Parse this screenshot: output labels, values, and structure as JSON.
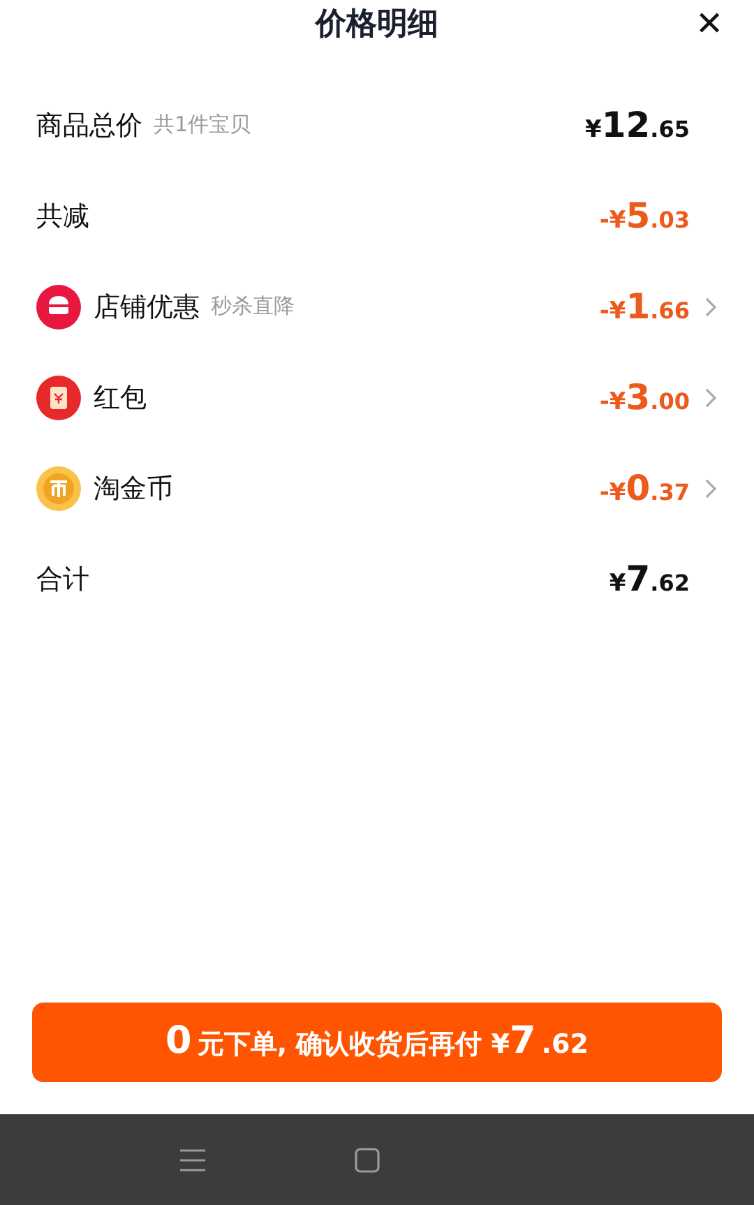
{
  "header": {
    "title": "价格明细",
    "close_icon": "✕"
  },
  "rows": [
    {
      "kind": "plain",
      "label": "商品总价",
      "note": "共1件宝贝",
      "discount": false,
      "amount": {
        "prefix": "¥",
        "int": "12",
        "dec": ".65"
      }
    },
    {
      "kind": "plain",
      "label": "共减",
      "discount": true,
      "amount": {
        "prefix": "-¥",
        "int": "5",
        "dec": ".03"
      }
    },
    {
      "kind": "shop",
      "label": "店铺优惠",
      "note": "秒杀直降",
      "discount": true,
      "amount": {
        "prefix": "-¥",
        "int": "1",
        "dec": ".66"
      }
    },
    {
      "kind": "envelope",
      "label": "红包",
      "discount": true,
      "amount": {
        "prefix": "-¥",
        "int": "3",
        "dec": ".00"
      }
    },
    {
      "kind": "coin",
      "label": "淘金币",
      "discount": true,
      "amount": {
        "prefix": "-¥",
        "int": "0",
        "dec": ".37"
      }
    },
    {
      "kind": "plain",
      "label": "合计",
      "discount": false,
      "amount": {
        "prefix": "¥",
        "int": "7",
        "dec": ".62"
      }
    }
  ],
  "pay_button": {
    "segments": [
      {
        "kind": "big",
        "text": "0"
      },
      {
        "kind": "normal",
        "text": "元下单, 确认收货后再付 ¥"
      },
      {
        "kind": "big",
        "text": "7"
      },
      {
        "kind": "normal",
        "text": ".62"
      }
    ]
  }
}
